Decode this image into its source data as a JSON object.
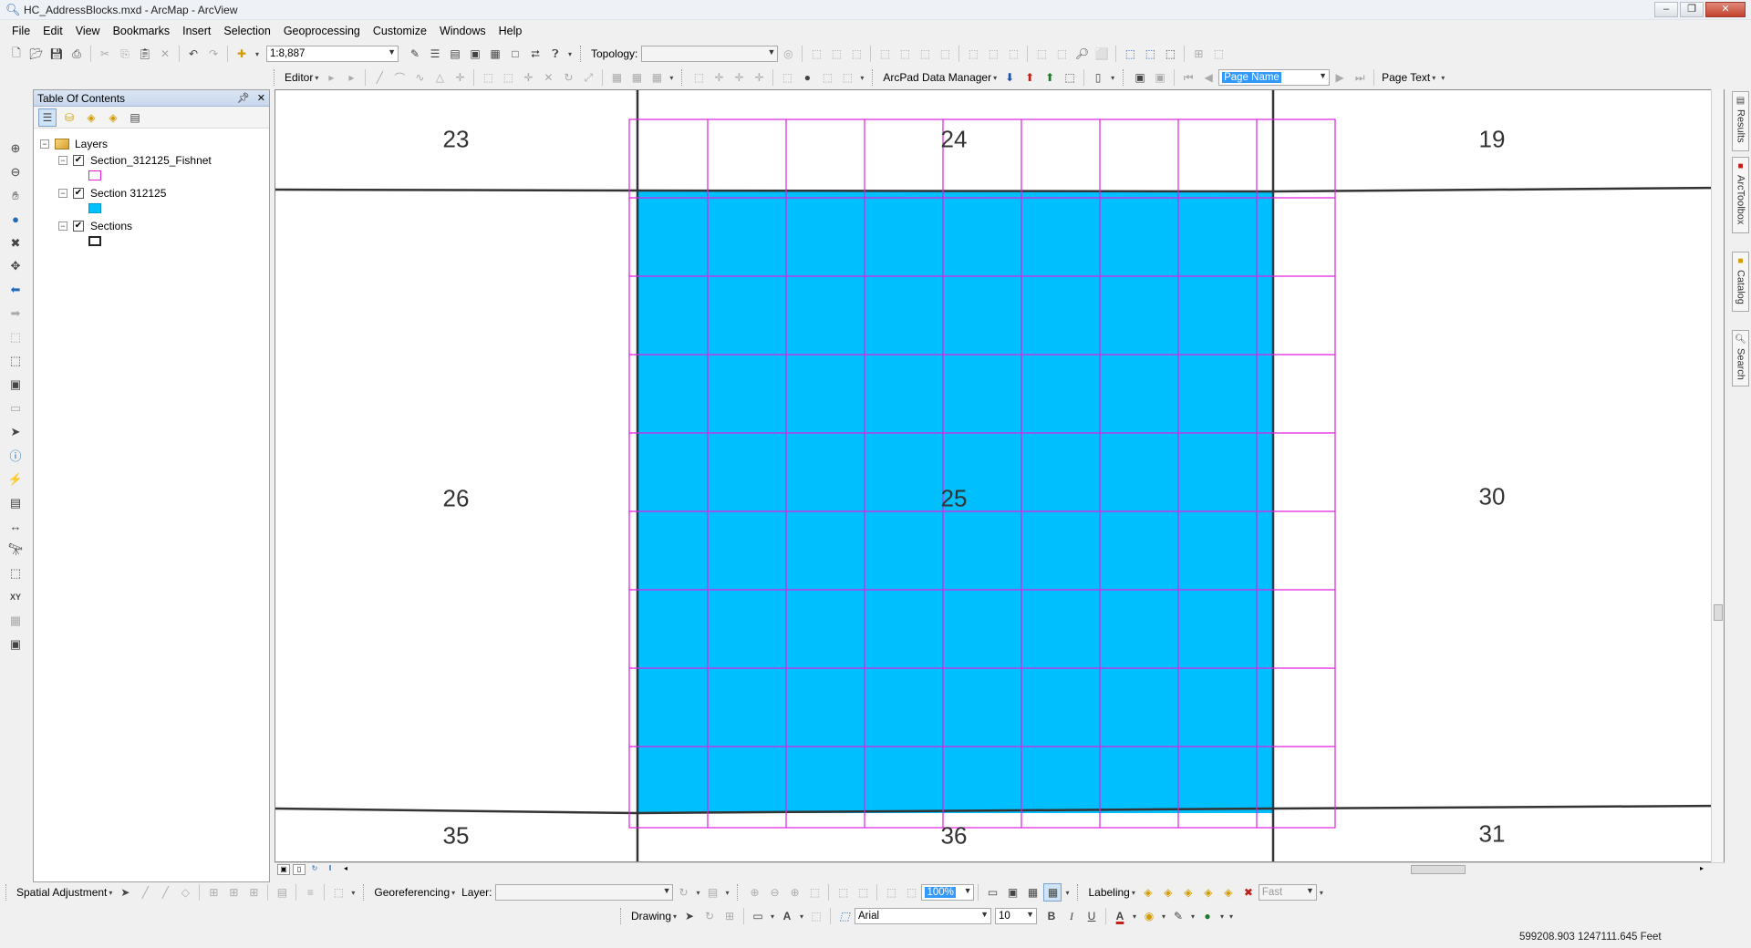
{
  "window": {
    "title": "HC_AddressBlocks.mxd - ArcMap - ArcView",
    "app_icon": "arcmap-magnifier-icon"
  },
  "menu": [
    "File",
    "Edit",
    "View",
    "Bookmarks",
    "Insert",
    "Selection",
    "Geoprocessing",
    "Customize",
    "Windows",
    "Help"
  ],
  "toolbar": {
    "scale_value": "1:8,887",
    "topology_label": "Topology:",
    "editor_label": "Editor",
    "arcpad_label": "ArcPad Data Manager",
    "page_name_value": "Page Name",
    "page_text_label": "Page Text"
  },
  "bottom_toolbars": {
    "spatial_adjustment_label": "Spatial Adjustment",
    "georeferencing_label": "Georeferencing",
    "layer_label": "Layer:",
    "zoom_value": "100%",
    "labeling_label": "Labeling",
    "fast_value": "Fast",
    "drawing_label": "Drawing",
    "font_value": "Arial",
    "font_size_value": "10",
    "bold": "B",
    "italic": "I",
    "underline": "U",
    "font_color_glyph": "A"
  },
  "toc": {
    "title": "Table Of Contents",
    "root_label": "Layers",
    "layers": [
      {
        "name": "Section_312125_Fishnet",
        "checked": true,
        "symbol": "hollow-magenta"
      },
      {
        "name": "Section 312125",
        "checked": true,
        "symbol": "cyan-fill"
      },
      {
        "name": "Sections",
        "checked": true,
        "symbol": "hollow-black"
      }
    ]
  },
  "map": {
    "section_labels": [
      "23",
      "24",
      "19",
      "26",
      "25",
      "30",
      "35",
      "36",
      "31"
    ],
    "colors": {
      "selected_fill": "#00bfff",
      "fishnet_stroke": "#e020e0",
      "section_stroke": "#333333"
    }
  },
  "dock_tabs": [
    "Results",
    "ArcToolbox",
    "Catalog",
    "Search"
  ],
  "status": {
    "coordinates": "599208.903  1247111.645 Feet"
  }
}
